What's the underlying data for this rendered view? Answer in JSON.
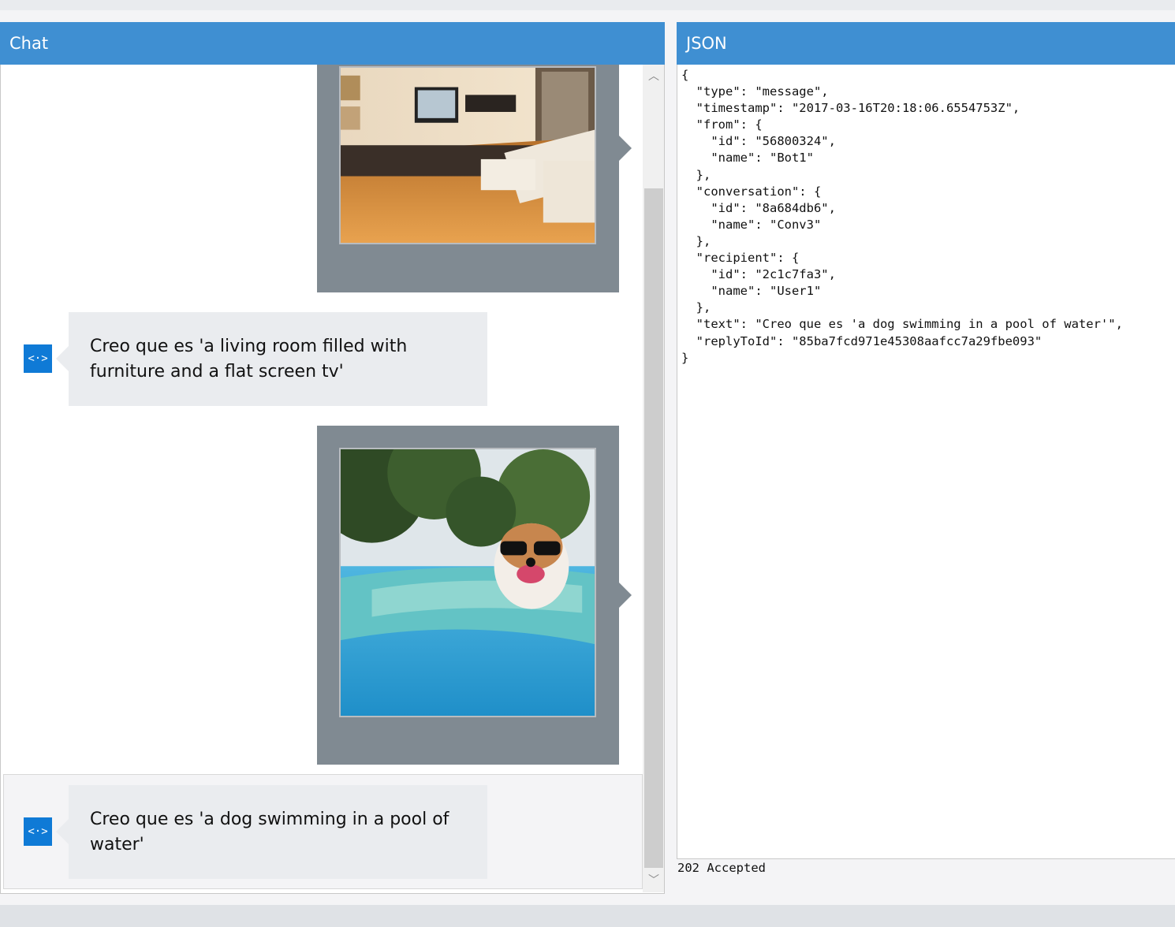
{
  "chat_panel": {
    "title": "Chat",
    "messages": [
      {
        "type": "image-attachment",
        "subject": "living room photo"
      },
      {
        "type": "bot-text",
        "avatar_icon": "bot-code-icon",
        "text": "Creo que es 'a living room filled with furniture and a flat screen tv'"
      },
      {
        "type": "image-attachment",
        "subject": "dog in pool photo"
      },
      {
        "type": "bot-text",
        "avatar_icon": "bot-code-icon",
        "text": "Creo que es 'a dog swimming in a pool of water'"
      }
    ]
  },
  "json_panel": {
    "title": "JSON",
    "content": "{\n  \"type\": \"message\",\n  \"timestamp\": \"2017-03-16T20:18:06.6554753Z\",\n  \"from\": {\n    \"id\": \"56800324\",\n    \"name\": \"Bot1\"\n  },\n  \"conversation\": {\n    \"id\": \"8a684db6\",\n    \"name\": \"Conv3\"\n  },\n  \"recipient\": {\n    \"id\": \"2c1c7fa3\",\n    \"name\": \"User1\"\n  },\n  \"text\": \"Creo que es 'a dog swimming in a pool of water'\",\n  \"replyToId\": \"85ba7fcd971e45308aafcc7a29fbe093\"\n}",
    "status": "202 Accepted"
  },
  "colors": {
    "header": "#3f8fd2",
    "card": "#808a92",
    "bubble": "#eaecef",
    "bot_avatar": "#0f7ad6"
  }
}
